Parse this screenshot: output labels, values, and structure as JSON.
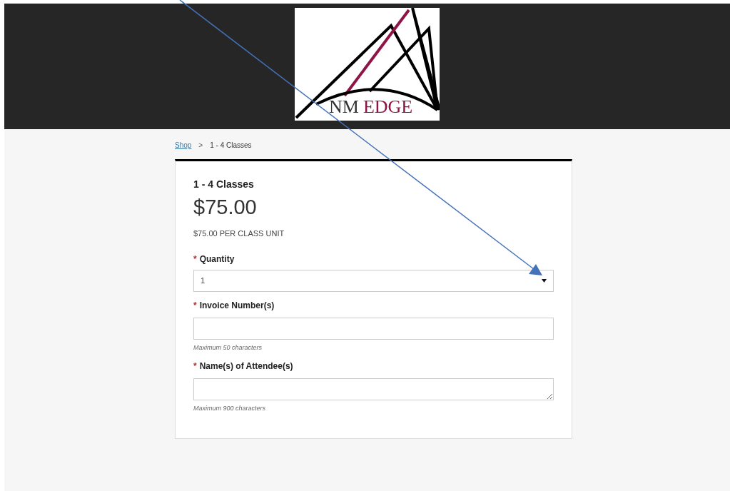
{
  "logo": {
    "text_parts": [
      {
        "text": "NM",
        "kind": "dark"
      },
      {
        "text": "EDGE",
        "kind": "accent"
      }
    ]
  },
  "breadcrumb": [
    {
      "label": "Shop",
      "kind": "link"
    },
    {
      "label": "1 - 4 Classes",
      "kind": "current"
    }
  ],
  "breadcrumb_separator": ">",
  "product": {
    "title": "1 - 4 Classes",
    "price": "$75.00",
    "unit_price": "$75.00 PER CLASS UNIT"
  },
  "fields": [
    {
      "kind": "select",
      "label": "Quantity",
      "required": true,
      "value": "1"
    },
    {
      "kind": "input",
      "label": "Invoice Number(s)",
      "required": true,
      "hint": "Maximum 50 characters"
    },
    {
      "kind": "textarea",
      "label": "Name(s) of Attendee(s)",
      "required": true,
      "hint": "Maximum 900 characters"
    }
  ],
  "required_mark": "*",
  "annotation": {
    "kind": "arrow"
  }
}
